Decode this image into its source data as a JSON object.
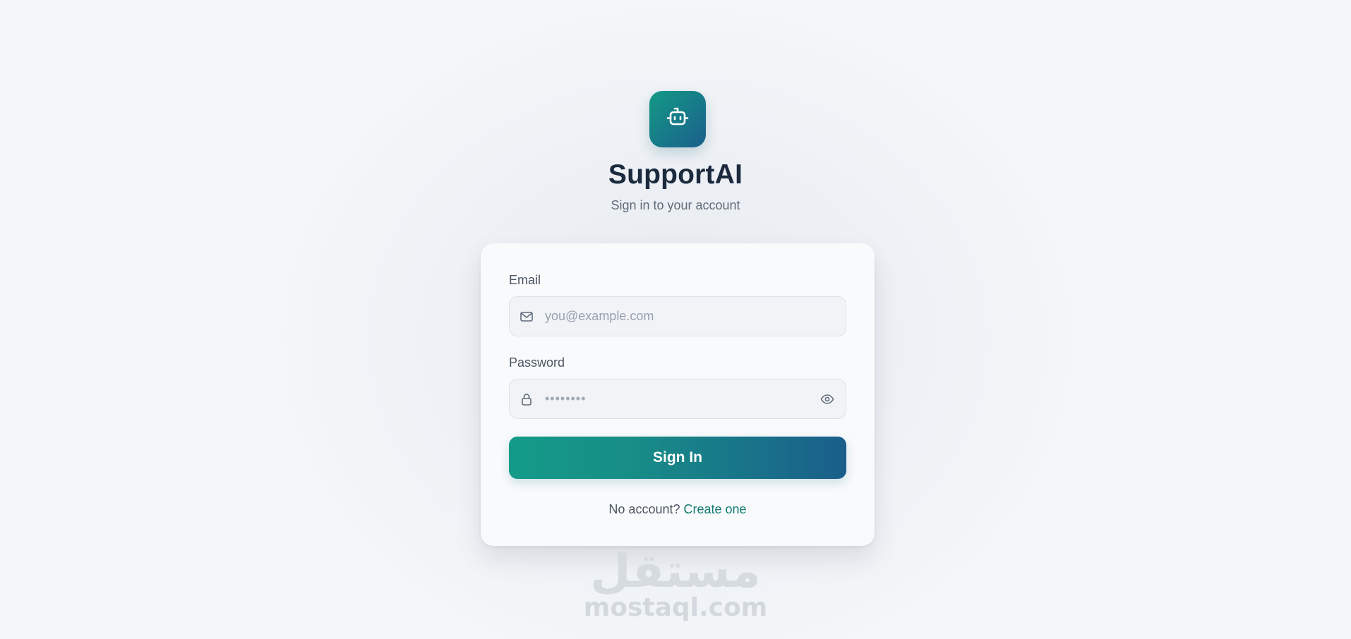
{
  "brand": {
    "name": "SupportAI",
    "subtitle": "Sign in to your account",
    "logo_icon": "robot-icon",
    "gradient_start": "#139a85",
    "gradient_end": "#1b5f8c"
  },
  "form": {
    "email": {
      "label": "Email",
      "placeholder": "you@example.com",
      "value": "",
      "icon": "mail-icon"
    },
    "password": {
      "label": "Password",
      "placeholder": "••••••••",
      "value": "",
      "icon": "lock-icon",
      "toggle_icon": "eye-icon"
    },
    "submit_label": "Sign In"
  },
  "footer": {
    "prompt": "No account?",
    "link_label": "Create one",
    "link_color": "#13796f"
  },
  "watermark": {
    "arabic_text": "مستقل",
    "latin_text": "mostaql.com"
  }
}
